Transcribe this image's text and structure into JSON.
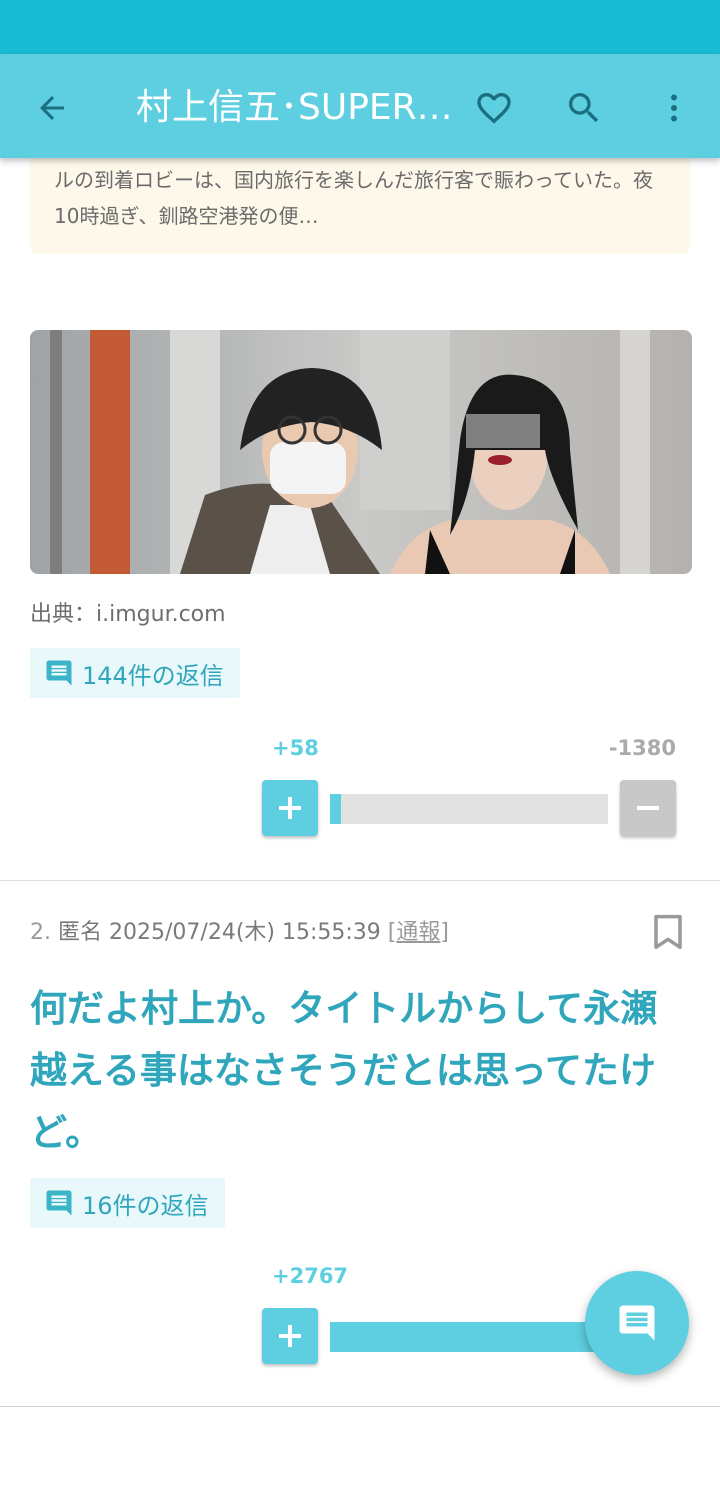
{
  "app_bar": {
    "title": "村上信五･SUPER EIGHT",
    "back_icon": "arrow-back-icon",
    "favorite_icon": "heart-outline-icon",
    "search_icon": "search-icon",
    "more_icon": "more-vert-icon"
  },
  "article_summary": {
    "text": "ルの到着ロビーは、国内旅行を楽しんだ旅行客で賑わっていた。夜10時過ぎ、釧路空港発の便…"
  },
  "post1": {
    "image_description": "photo-of-man-in-bucket-hat-and-mask-with-woman",
    "source_label": "出典：",
    "source_value": "i.imgur.com",
    "replies_label": "144件の返信",
    "plus_label": "+58",
    "minus_label": "-1380",
    "plus_votes": 58,
    "minus_votes": 1380,
    "plus_button": "+",
    "minus_button": "−"
  },
  "post2": {
    "number": "2.",
    "author": "匿名",
    "datetime": "2025/07/24(木) 15:55:39",
    "report_open": "[",
    "report_label": "通報",
    "report_close": "]",
    "body": "何だよ村上か。タイトルからして永瀬越える事はなさそうだとは思ってたけど。",
    "replies_label": "16件の返信",
    "plus_label": "+2767",
    "plus_button": "+",
    "plus_votes": 2767
  },
  "colors": {
    "status_bar": "#18bcd3",
    "app_bar": "#5ecfe0",
    "accent_text": "#2fa6bb",
    "summary_bg": "#fdf8ea"
  },
  "fab": {
    "icon": "comment-icon"
  }
}
